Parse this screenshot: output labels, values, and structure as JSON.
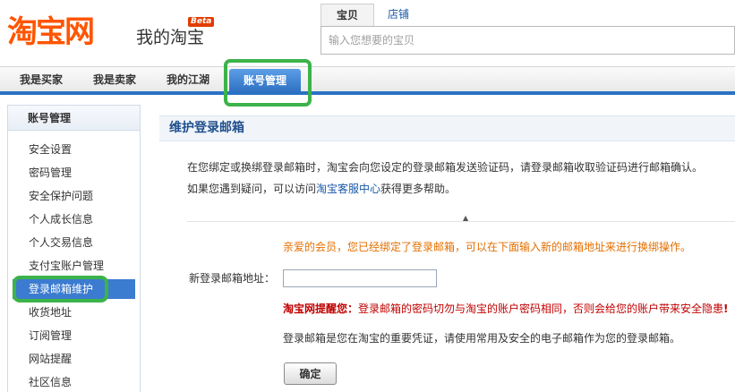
{
  "header": {
    "logo_main": "淘宝网",
    "logo_sub": "我的淘宝",
    "logo_badge": "Beta"
  },
  "search": {
    "tabs": [
      {
        "label": "宝贝",
        "active": true
      },
      {
        "label": "店铺",
        "active": false
      }
    ],
    "placeholder": "输入您想要的宝贝"
  },
  "nav": {
    "items": [
      {
        "label": "我是买家"
      },
      {
        "label": "我是卖家"
      },
      {
        "label": "我的江湖"
      },
      {
        "label": "账号管理",
        "active": true
      }
    ]
  },
  "sidebar": {
    "title": "账号管理",
    "items": [
      {
        "label": "安全设置"
      },
      {
        "label": "密码管理"
      },
      {
        "label": "安全保护问题"
      },
      {
        "label": "个人成长信息"
      },
      {
        "label": "个人交易信息"
      },
      {
        "label": "支付宝账户管理"
      },
      {
        "label": "登录邮箱维护",
        "active": true
      },
      {
        "label": "收货地址"
      },
      {
        "label": "订阅管理"
      },
      {
        "label": "网站提醒"
      },
      {
        "label": "社区信息"
      }
    ]
  },
  "main": {
    "title": "维护登录邮箱",
    "intro_line1": "在您绑定或换绑登录邮箱时，淘宝会向您设定的登录邮箱发送验证码，请登录邮箱收取验证码进行邮箱确认。",
    "intro_line2_prefix": "如果您遇到疑问，可以访问",
    "intro_line2_link": "淘宝客服中心",
    "intro_line2_suffix": "获得更多帮助。",
    "notice": "亲爱的会员，您已经绑定了登录邮箱，可以在下面输入新的邮箱地址来进行换绑操作。",
    "email_label": "新登录邮箱地址：",
    "email_value": "",
    "warning_prefix": "淘宝网提醒您：",
    "warning_text": "登录邮箱的密码切勿与淘宝的账户密码相同，否则会给您的账户带来安全隐患",
    "warning_end": "!",
    "description": "登录邮箱是您在淘宝的重要凭证，请使用常用及安全的电子邮箱作为您的登录邮箱。",
    "confirm_label": "确定"
  },
  "colors": {
    "brand_orange": "#ff5500",
    "nav_blue": "#2a72c4",
    "highlight_green": "#3cb34a",
    "warning_red": "#c00000",
    "notice_orange": "#e46f00"
  }
}
